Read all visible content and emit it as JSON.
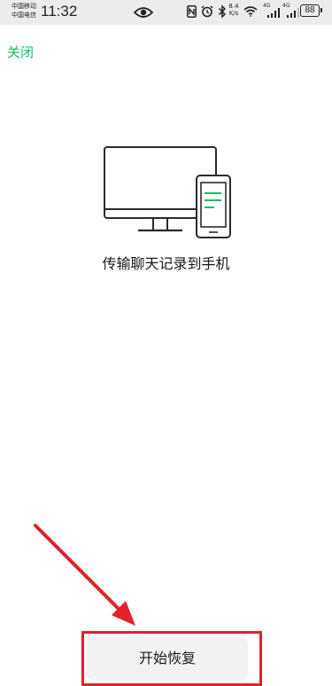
{
  "status_bar": {
    "carrier_1": "中国移动",
    "carrier_2": "中国电信",
    "time": "11:32",
    "net_speed_value": "8.4",
    "net_speed_unit": "K/s",
    "signal_1_label": "4G",
    "signal_2_label": "4G",
    "battery_level": "88",
    "icons": [
      "eye-icon",
      "nfc-icon",
      "alarm-icon",
      "bluetooth-icon",
      "wifi-icon",
      "signal-icon",
      "battery-icon"
    ]
  },
  "nav": {
    "close_label": "关闭"
  },
  "main": {
    "illustration": "computer-to-phone-icon",
    "caption": "传输聊天记录到手机"
  },
  "footer": {
    "restore_button_label": "开始恢复"
  },
  "colors": {
    "accent": "#07c160",
    "annotation": "#e0222b",
    "button_bg": "#f2f2f2",
    "status_bar_bg": "#ececec"
  }
}
